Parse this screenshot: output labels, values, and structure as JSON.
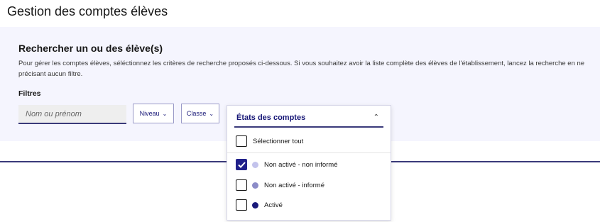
{
  "page": {
    "title": "Gestion des comptes élèves"
  },
  "search": {
    "title": "Rechercher un ou des élève(s)",
    "intro": "Pour gérer les comptes élèves, séléctionnez les critères de recherche proposés ci-dessous. Si vous souhaitez avoir la liste complète des élèves de l'établissement, lancez la recherche en ne précisant aucun filtre.",
    "filters_label": "Filtres",
    "name_placeholder": "Nom ou prénom",
    "niveau_label": "Niveau",
    "classe_label": "Classe"
  },
  "dropdown": {
    "header": "États des comptes",
    "caret_icon": "chevron-up-icon",
    "select_all": "Sélectionner tout",
    "options": [
      {
        "label": "Non activé - non informé",
        "checked": true,
        "color": "#c3c3ec"
      },
      {
        "label": "Non activé - informé",
        "checked": false,
        "color": "#8c8cc8"
      },
      {
        "label": "Activé",
        "checked": false,
        "color": "#1a1a7a"
      }
    ]
  },
  "colors": {
    "accent": "#20208a",
    "panel_bg": "#f5f5fe",
    "rule": "#3a3a7a"
  }
}
